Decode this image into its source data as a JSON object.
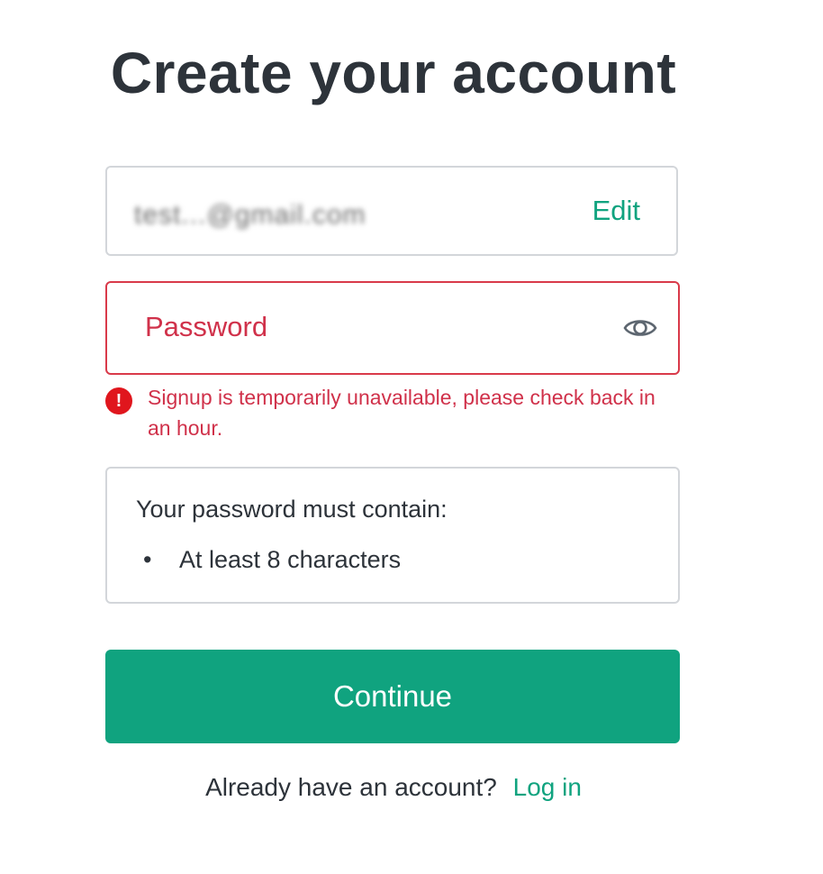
{
  "page": {
    "title": "Create your account"
  },
  "email": {
    "value": "test...@gmail.com",
    "edit_label": "Edit"
  },
  "password": {
    "placeholder": "Password",
    "value": "",
    "toggle_icon": "eye-icon"
  },
  "error": {
    "icon": "error-icon",
    "icon_glyph": "!",
    "message": "Signup is temporarily unavailable, please check back in an hour."
  },
  "requirements": {
    "heading": "Your password must contain:",
    "items": [
      "At least 8 characters"
    ]
  },
  "continue_button": {
    "label": "Continue"
  },
  "footer": {
    "prompt": "Already have an account?",
    "login_label": "Log in"
  },
  "colors": {
    "accent": "#10a37f",
    "error": "#d0314a",
    "error_icon_bg": "#e0161d",
    "text": "#2d333a",
    "border": "#d3d6da"
  }
}
